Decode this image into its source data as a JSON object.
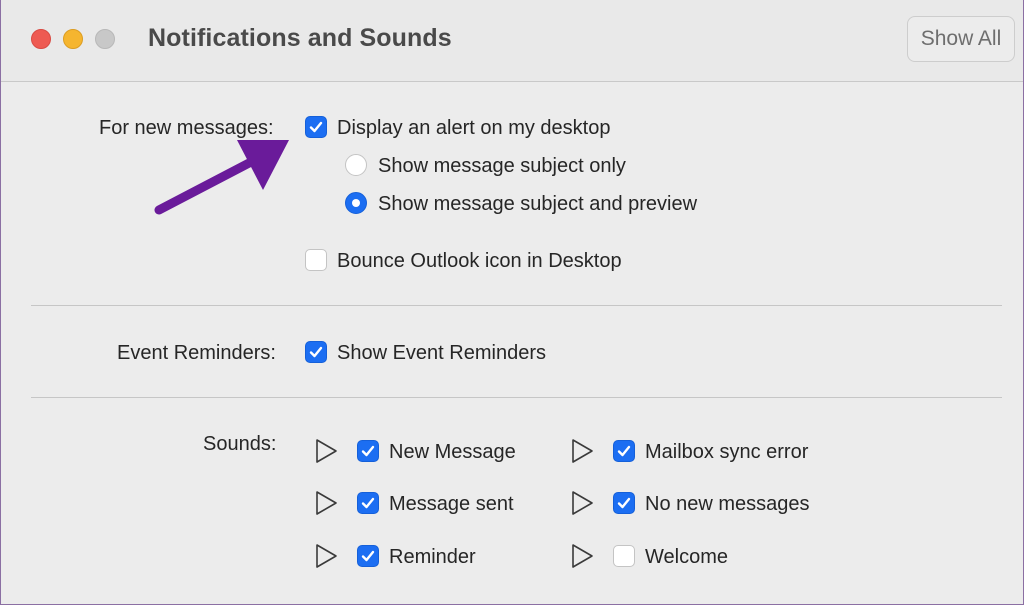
{
  "window": {
    "title": "Notifications and Sounds",
    "show_all_label": "Show All"
  },
  "new_messages": {
    "label": "For new messages:",
    "display_alert": {
      "label": "Display an alert on my desktop",
      "checked": true
    },
    "options": [
      {
        "label": "Show message subject only",
        "selected": false
      },
      {
        "label": "Show message subject and preview",
        "selected": true
      }
    ],
    "bounce_icon": {
      "label": "Bounce Outlook icon in Desktop",
      "checked": false
    }
  },
  "event_reminders": {
    "label": "Event Reminders:",
    "show": {
      "label": "Show Event Reminders",
      "checked": true
    }
  },
  "sounds": {
    "label": "Sounds:",
    "items": [
      {
        "label": "New Message",
        "checked": true
      },
      {
        "label": "Mailbox sync error",
        "checked": true
      },
      {
        "label": "Message sent",
        "checked": true
      },
      {
        "label": "No new messages",
        "checked": true
      },
      {
        "label": "Reminder",
        "checked": true
      },
      {
        "label": "Welcome",
        "checked": false
      }
    ]
  },
  "colors": {
    "accent": "#1c6ef2",
    "annotation_arrow": "#6a1b9a"
  }
}
